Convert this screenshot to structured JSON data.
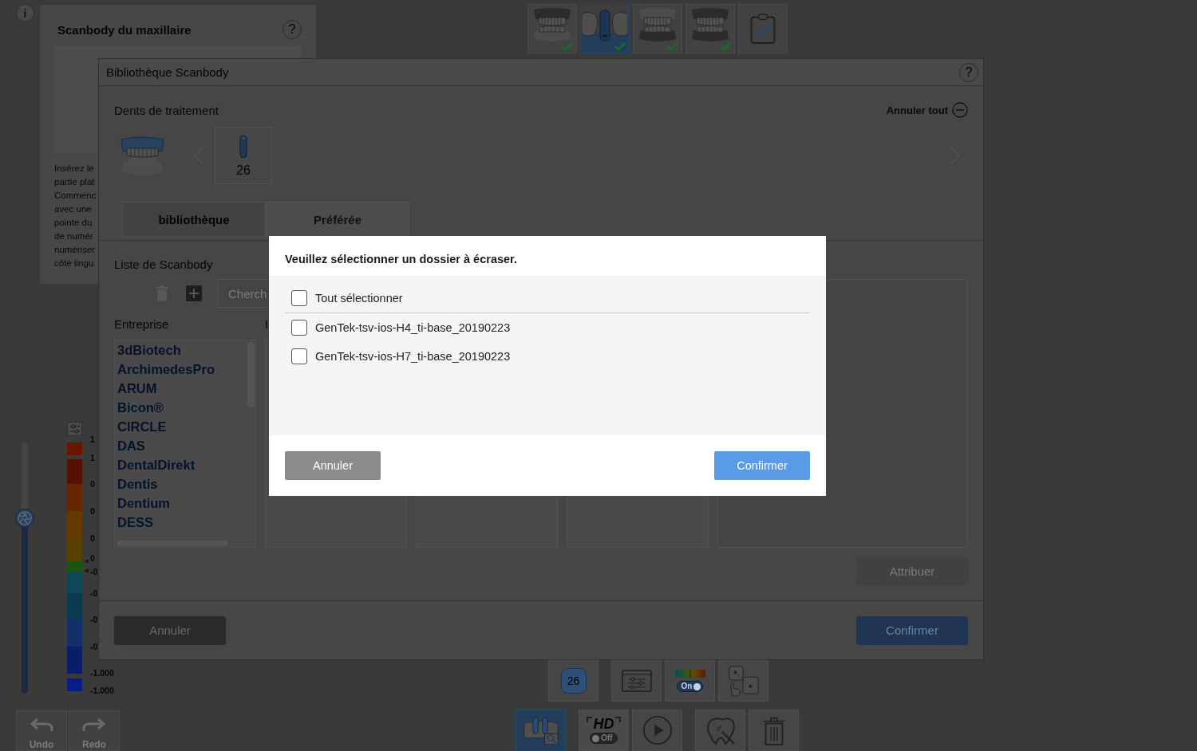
{
  "info_button": "i",
  "side_panel": {
    "title": "Scanbody du maxillaire",
    "help": "?",
    "description_lines": [
      "Insérez le",
      "partie plat",
      "Commenc",
      "avec une",
      "pointe du",
      "de numér",
      "numériser",
      "côté lingu"
    ]
  },
  "top_toolbar": {
    "steps": [
      {
        "kind": "upper-jaw",
        "selected": false,
        "completed": true
      },
      {
        "kind": "scanbody",
        "selected": true,
        "completed": true
      },
      {
        "kind": "lower-jaw",
        "selected": false,
        "completed": true
      },
      {
        "kind": "bite",
        "selected": false,
        "completed": true
      },
      {
        "kind": "review",
        "selected": false,
        "completed": false
      }
    ]
  },
  "deviation_scale": {
    "level": 0.7,
    "segments": [
      {
        "color": "#6b1400"
      },
      {
        "color": "#581000"
      },
      {
        "color": "#662600"
      },
      {
        "color": "#643a00"
      },
      {
        "color": "#574200"
      },
      {
        "color": "#1c5412"
      },
      {
        "color": "#0f4658"
      },
      {
        "color": "#0c3a52"
      },
      {
        "color": "#122f6a"
      },
      {
        "color": "#0a1e68"
      },
      {
        "color": "#0a1c86"
      }
    ],
    "labels": [
      "1",
      "1",
      "0",
      "0",
      "0",
      "0",
      "-0",
      "-0",
      "-0",
      "-0",
      "-1.000",
      "-1.000"
    ]
  },
  "history_buttons": [
    {
      "kind": "undo",
      "label": "Undo"
    },
    {
      "kind": "redo",
      "label": "Redo"
    }
  ],
  "library_dialog": {
    "title": "Bibliothèque Scanbody",
    "help": "?",
    "treatment_label": "Dents de traitement",
    "clear_all": "Annuler tout",
    "teeth": [
      "26"
    ],
    "tabs": [
      {
        "label": "bibliothèque",
        "selected": true
      },
      {
        "label": "Préférée",
        "selected": false
      }
    ],
    "list_title": "Liste de Scanbody",
    "search": {
      "placeholder": "Cherch"
    },
    "columns": [
      {
        "heading": "Entreprise",
        "items": [
          "3dBiotech",
          "ArchimedesPro",
          "ARUM",
          "Bicon®",
          "CIRCLE",
          "DAS",
          "DentalDirekt",
          "Dentis",
          "Dentium",
          "DESS"
        ]
      },
      {
        "heading": "I"
      }
    ],
    "assign_button": {
      "label": "Attribuer",
      "disabled": true
    },
    "buttons": [
      {
        "kind": "cancel",
        "label": "Annuler"
      },
      {
        "kind": "confirm",
        "label": "Confirmer"
      }
    ]
  },
  "bottom_toolbar": {
    "rows": [
      [
        [
          {
            "kind": "tooth-number",
            "label": "26"
          }
        ],
        [
          {
            "kind": "display-settings"
          },
          {
            "kind": "color-map",
            "toggle": {
              "label": "On",
              "on": true
            }
          },
          {
            "kind": "point-match"
          }
        ]
      ],
      [
        [
          {
            "kind": "scan-view",
            "selected": true
          }
        ],
        [
          {
            "kind": "hd",
            "label": "HD",
            "toggle": {
              "label": "Off",
              "on": false
            },
            "selected": false
          },
          {
            "kind": "play",
            "selected": false
          }
        ],
        [
          {
            "kind": "tooth-edit",
            "selected": false
          },
          {
            "kind": "delete",
            "selected": false
          }
        ]
      ]
    ]
  },
  "overwrite_dialog": {
    "title": "Veuillez sélectionner un dossier à écraser.",
    "select_all": {
      "label": "Tout sélectionner",
      "checked": false
    },
    "folders": [
      {
        "label": "GenTek-tsv-ios-H4_ti-base_20190223",
        "checked": false
      },
      {
        "label": "GenTek-tsv-ios-H7_ti-base_20190223",
        "checked": false
      }
    ],
    "buttons": [
      {
        "kind": "cancel",
        "label": "Annuler"
      },
      {
        "kind": "confirm",
        "label": "Confirmer"
      }
    ]
  }
}
